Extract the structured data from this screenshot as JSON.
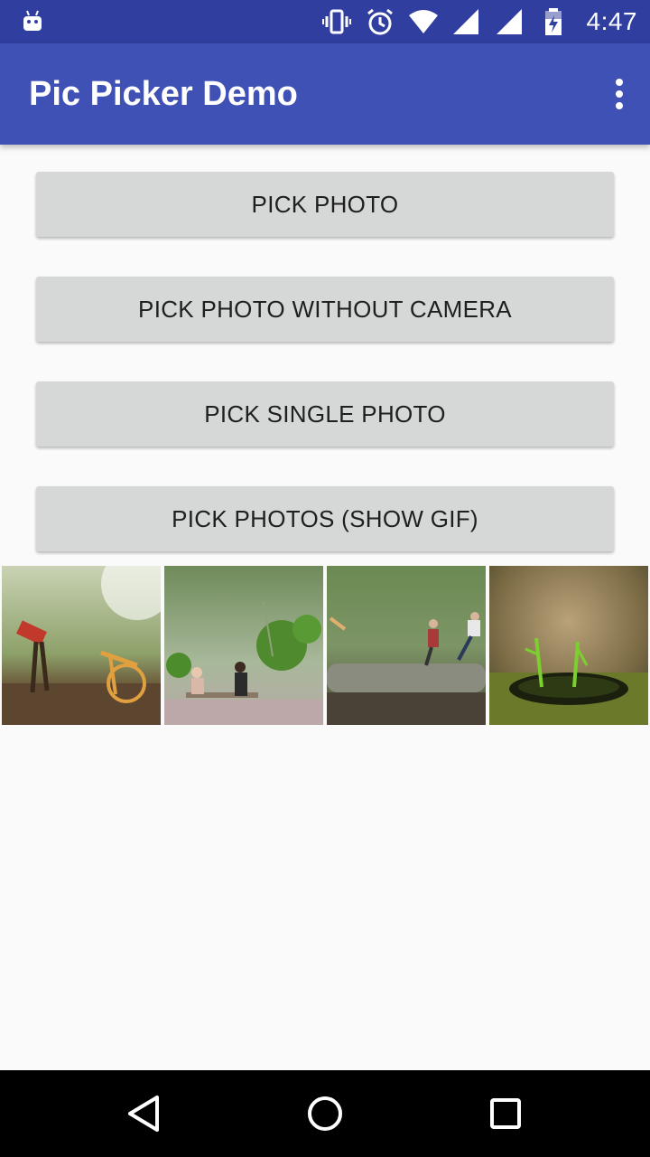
{
  "status_bar": {
    "time": "4:47",
    "icons": [
      "android-icon",
      "vibrate-icon",
      "alarm-icon",
      "wifi-icon",
      "signal-icon",
      "signal-icon-2",
      "battery-charging-icon"
    ]
  },
  "app_bar": {
    "title": "Pic Picker Demo",
    "menu_icon": "overflow-menu-icon"
  },
  "buttons": {
    "pick_photo": "PICK PHOTO",
    "pick_photo_without_camera": "PICK PHOTO WITHOUT CAMERA",
    "pick_single_photo": "PICK SINGLE PHOTO",
    "pick_photos_show_gif": "PICK PHOTOS (SHOW GIF)"
  },
  "thumbnails": [
    {
      "description_icon": "photo-thumbnail-1"
    },
    {
      "description_icon": "photo-thumbnail-2"
    },
    {
      "description_icon": "photo-thumbnail-3"
    },
    {
      "description_icon": "photo-thumbnail-4"
    }
  ],
  "nav_bar": {
    "icons": [
      "back-icon",
      "home-icon",
      "recents-icon"
    ]
  },
  "colors": {
    "status_bar": "#303f9f",
    "app_bar": "#3f51b5",
    "button": "#d6d7d7",
    "background": "#fafafa"
  }
}
